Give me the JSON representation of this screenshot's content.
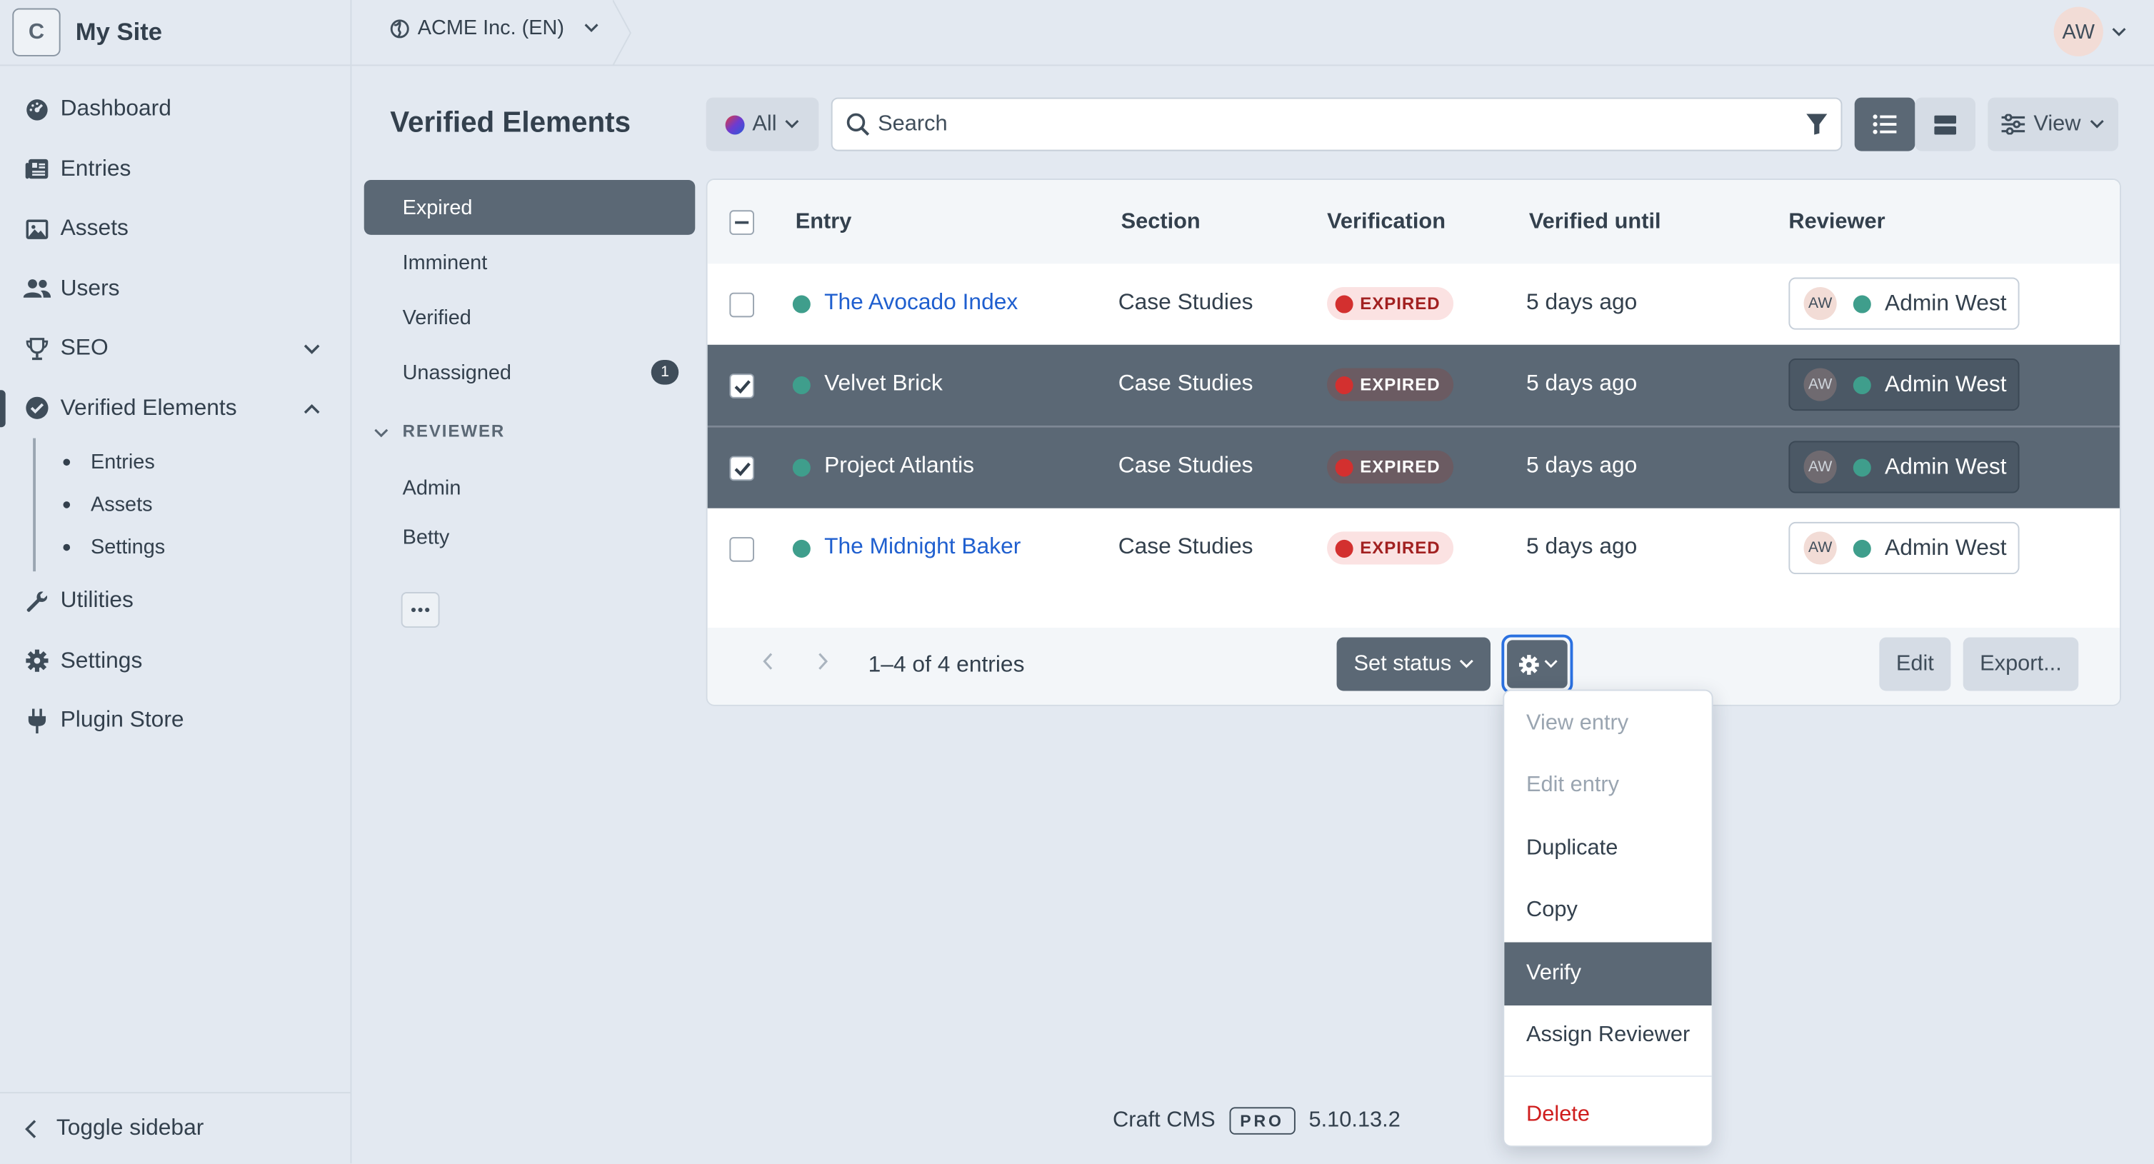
{
  "site": {
    "logo_letter": "C",
    "name": "My Site"
  },
  "header": {
    "site_switcher": "ACME Inc. (EN)",
    "user_initials": "AW"
  },
  "sidebar": {
    "items": [
      {
        "label": "Dashboard",
        "icon": "gauge-icon"
      },
      {
        "label": "Entries",
        "icon": "newspaper-icon"
      },
      {
        "label": "Assets",
        "icon": "image-icon"
      },
      {
        "label": "Users",
        "icon": "users-icon"
      },
      {
        "label": "SEO",
        "icon": "trophy-icon"
      },
      {
        "label": "Verified Elements",
        "icon": "check-badge-icon"
      },
      {
        "label": "Utilities",
        "icon": "wrench-icon"
      },
      {
        "label": "Settings",
        "icon": "gear-icon"
      },
      {
        "label": "Plugin Store",
        "icon": "plug-icon"
      }
    ],
    "subitems": [
      "Entries",
      "Assets",
      "Settings"
    ],
    "toggle": "Toggle sidebar"
  },
  "page": {
    "title": "Verified Elements"
  },
  "toolbar": {
    "site_filter": "All",
    "search_placeholder": "Search",
    "view_label": "View"
  },
  "sources": {
    "items": [
      {
        "label": "Expired",
        "selected": true
      },
      {
        "label": "Imminent"
      },
      {
        "label": "Verified"
      },
      {
        "label": "Unassigned",
        "badge": "1"
      }
    ],
    "heading": "REVIEWER",
    "reviewers": [
      "Admin",
      "Betty"
    ]
  },
  "table": {
    "columns": [
      "Entry",
      "Section",
      "Verification",
      "Verified until",
      "Reviewer"
    ],
    "rows": [
      {
        "entry": "The Avocado Index",
        "section": "Case Studies",
        "status": "EXPIRED",
        "until": "5 days ago",
        "reviewer": "Admin West",
        "initials": "AW",
        "selected": false
      },
      {
        "entry": "Velvet Brick",
        "section": "Case Studies",
        "status": "EXPIRED",
        "until": "5 days ago",
        "reviewer": "Admin West",
        "initials": "AW",
        "selected": true
      },
      {
        "entry": "Project Atlantis",
        "section": "Case Studies",
        "status": "EXPIRED",
        "until": "5 days ago",
        "reviewer": "Admin West",
        "initials": "AW",
        "selected": true
      },
      {
        "entry": "The Midnight Baker",
        "section": "Case Studies",
        "status": "EXPIRED",
        "until": "5 days ago",
        "reviewer": "Admin West",
        "initials": "AW",
        "selected": false
      }
    ],
    "count_text": "1–4 of 4 entries",
    "set_status": "Set status",
    "edit": "Edit",
    "export": "Export..."
  },
  "menu": {
    "items": [
      "View entry",
      "Edit entry",
      "Duplicate",
      "Copy",
      "Verify",
      "Assign Reviewer",
      "Delete"
    ]
  },
  "footer": {
    "product": "Craft CMS",
    "edition": "PRO",
    "version": "5.10.13.2"
  }
}
